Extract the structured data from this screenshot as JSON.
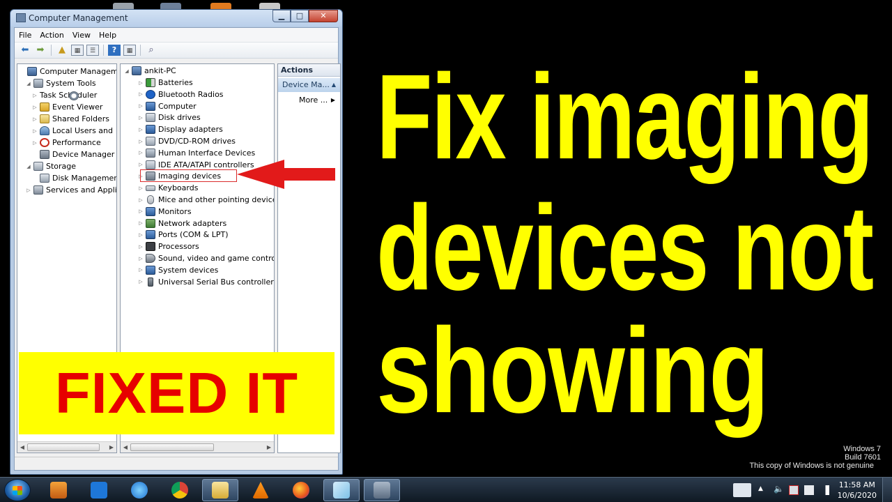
{
  "window": {
    "title": "Computer Management",
    "menu": [
      "File",
      "Action",
      "View",
      "Help"
    ]
  },
  "left_tree": [
    {
      "label": "Computer Management",
      "icon": "computer-management-icon",
      "arrow": ""
    },
    {
      "label": "System Tools",
      "icon": "tools-icon",
      "arrow": "◢"
    },
    {
      "label": "Task Scheduler",
      "icon": "clock-icon",
      "arrow": "▷"
    },
    {
      "label": "Event Viewer",
      "icon": "event-viewer-icon",
      "arrow": "▷"
    },
    {
      "label": "Shared Folders",
      "icon": "folder-icon",
      "arrow": "▷"
    },
    {
      "label": "Local Users and",
      "icon": "users-icon",
      "arrow": "▷"
    },
    {
      "label": "Performance",
      "icon": "performance-icon",
      "arrow": "▷"
    },
    {
      "label": "Device Manager",
      "icon": "device-manager-icon",
      "arrow": ""
    },
    {
      "label": "Storage",
      "icon": "storage-icon",
      "arrow": "◢"
    },
    {
      "label": "Disk Managemen",
      "icon": "disk-icon",
      "arrow": ""
    },
    {
      "label": "Services and Applica",
      "icon": "services-icon",
      "arrow": "▷"
    }
  ],
  "device_tree": {
    "root": "ankit-PC",
    "categories": [
      {
        "label": "Batteries",
        "icon": "battery-icon"
      },
      {
        "label": "Bluetooth Radios",
        "icon": "bluetooth-icon"
      },
      {
        "label": "Computer",
        "icon": "computer-icon"
      },
      {
        "label": "Disk drives",
        "icon": "disk-drive-icon"
      },
      {
        "label": "Display adapters",
        "icon": "display-adapter-icon"
      },
      {
        "label": "DVD/CD-ROM drives",
        "icon": "dvd-icon"
      },
      {
        "label": "Human Interface Devices",
        "icon": "hid-icon"
      },
      {
        "label": "IDE ATA/ATAPI controllers",
        "icon": "ide-icon"
      },
      {
        "label": "Imaging devices",
        "icon": "imaging-icon"
      },
      {
        "label": "Keyboards",
        "icon": "keyboard-icon"
      },
      {
        "label": "Mice and other pointing devices",
        "icon": "mouse-icon"
      },
      {
        "label": "Monitors",
        "icon": "monitor-icon"
      },
      {
        "label": "Network adapters",
        "icon": "network-icon"
      },
      {
        "label": "Ports (COM & LPT)",
        "icon": "ports-icon"
      },
      {
        "label": "Processors",
        "icon": "processor-icon"
      },
      {
        "label": "Sound, video and game controlle",
        "icon": "sound-icon"
      },
      {
        "label": "System devices",
        "icon": "system-devices-icon"
      },
      {
        "label": "Universal Serial Bus controllers",
        "icon": "usb-icon"
      }
    ]
  },
  "actions": {
    "header": "Actions",
    "section": "Device Ma...",
    "more": "More ..."
  },
  "banner": {
    "text": "FIXED IT",
    "bg_color": "#ffff00",
    "text_color": "#e60000"
  },
  "headline": {
    "lines": [
      "Fix imaging",
      "devices not",
      "showing"
    ],
    "color": "#ffff00"
  },
  "watermark": {
    "line1": "Windows 7",
    "line2": "Build 7601",
    "line3": "This copy of Windows is not genuine"
  },
  "taskbar": {
    "time": "11:58 AM",
    "date": "10/6/2020",
    "apps": [
      "start-button",
      "media-player",
      "screen-capture",
      "internet-explorer",
      "chrome",
      "file-explorer",
      "vlc",
      "firefox",
      "notepad",
      "computer-management"
    ]
  }
}
